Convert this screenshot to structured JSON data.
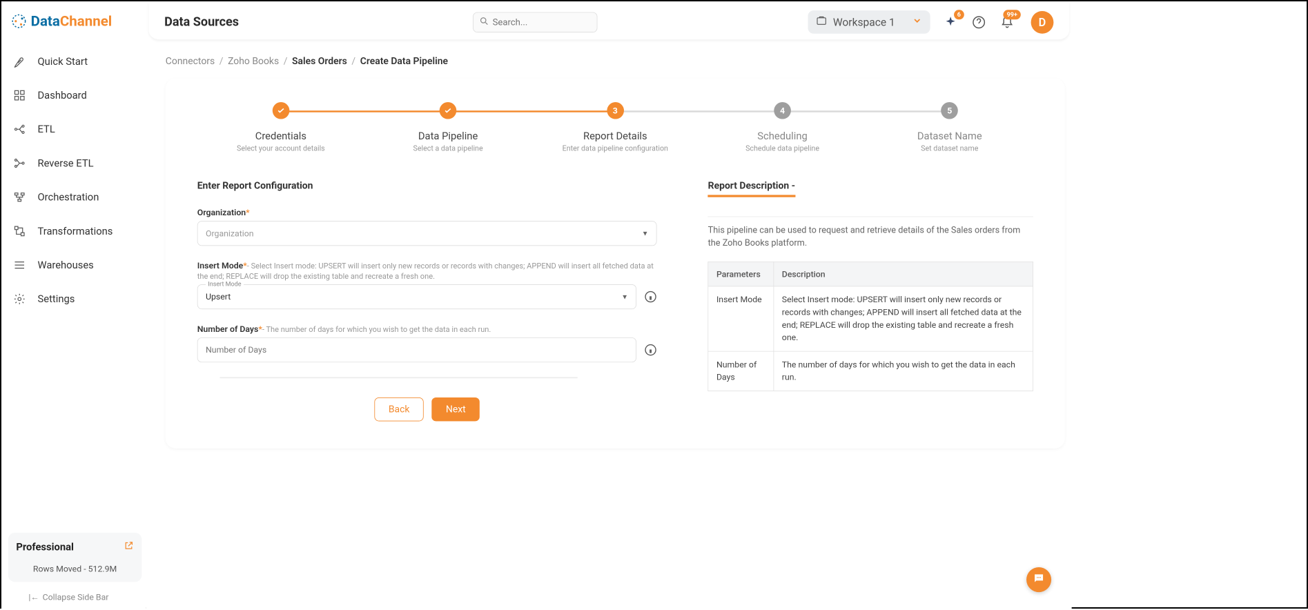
{
  "brand": {
    "data": "Data",
    "channel": "Channel"
  },
  "sidebar": {
    "items": [
      {
        "label": "Quick Start",
        "icon": "rocket"
      },
      {
        "label": "Dashboard",
        "icon": "grid"
      },
      {
        "label": "ETL",
        "icon": "etl"
      },
      {
        "label": "Reverse ETL",
        "icon": "reverse"
      },
      {
        "label": "Orchestration",
        "icon": "orch"
      },
      {
        "label": "Transformations",
        "icon": "transform"
      },
      {
        "label": "Warehouses",
        "icon": "warehouse"
      },
      {
        "label": "Settings",
        "icon": "gear"
      }
    ],
    "plan": {
      "name": "Professional",
      "stat": "Rows Moved - 512.9M"
    },
    "collapse": "Collapse Side Bar"
  },
  "header": {
    "title": "Data Sources",
    "search_placeholder": "Search...",
    "workspace": "Workspace 1",
    "spark_badge": "6",
    "bell_badge": "99+",
    "avatar": "D"
  },
  "breadcrumbs": [
    {
      "label": "Connectors",
      "active": false
    },
    {
      "label": "Zoho Books",
      "active": false
    },
    {
      "label": "Sales Orders",
      "active": true
    },
    {
      "label": "Create Data Pipeline",
      "active": true
    }
  ],
  "stepper": [
    {
      "title": "Credentials",
      "sub": "Select your account details",
      "state": "done"
    },
    {
      "title": "Data Pipeline",
      "sub": "Select a data pipeline",
      "state": "done"
    },
    {
      "title": "Report Details",
      "sub": "Enter data pipeline configuration",
      "state": "current",
      "num": "3"
    },
    {
      "title": "Scheduling",
      "sub": "Schedule data pipeline",
      "state": "future",
      "num": "4"
    },
    {
      "title": "Dataset Name",
      "sub": "Set dataset name",
      "state": "future",
      "num": "5"
    }
  ],
  "form": {
    "title": "Enter Report Configuration",
    "organization": {
      "label": "Organization",
      "placeholder": "Organization"
    },
    "insert_mode": {
      "label": "Insert Mode",
      "hint": "- Select Insert mode: UPSERT will insert only new records or records with changes; APPEND will insert all fetched data at the end; REPLACE will drop the existing table and recreate a fresh one.",
      "float": "Insert Mode",
      "value": "Upsert"
    },
    "num_days": {
      "label": "Number of Days",
      "hint": "- The number of days for which you wish to get the data in each run.",
      "placeholder": "Number of Days"
    }
  },
  "desc": {
    "title": "Report Description -",
    "text": "This pipeline can be used to request and retrieve details of the Sales orders from the Zoho Books platform.",
    "table": {
      "headers": [
        "Parameters",
        "Description"
      ],
      "rows": [
        [
          "Insert Mode",
          "Select Insert mode: UPSERT will insert only new records or records with changes; APPEND will insert all fetched data at the end; REPLACE will drop the existing table and recreate a fresh one."
        ],
        [
          "Number of Days",
          "The number of days for which you wish to get the data in each run."
        ]
      ]
    }
  },
  "actions": {
    "back": "Back",
    "next": "Next"
  }
}
